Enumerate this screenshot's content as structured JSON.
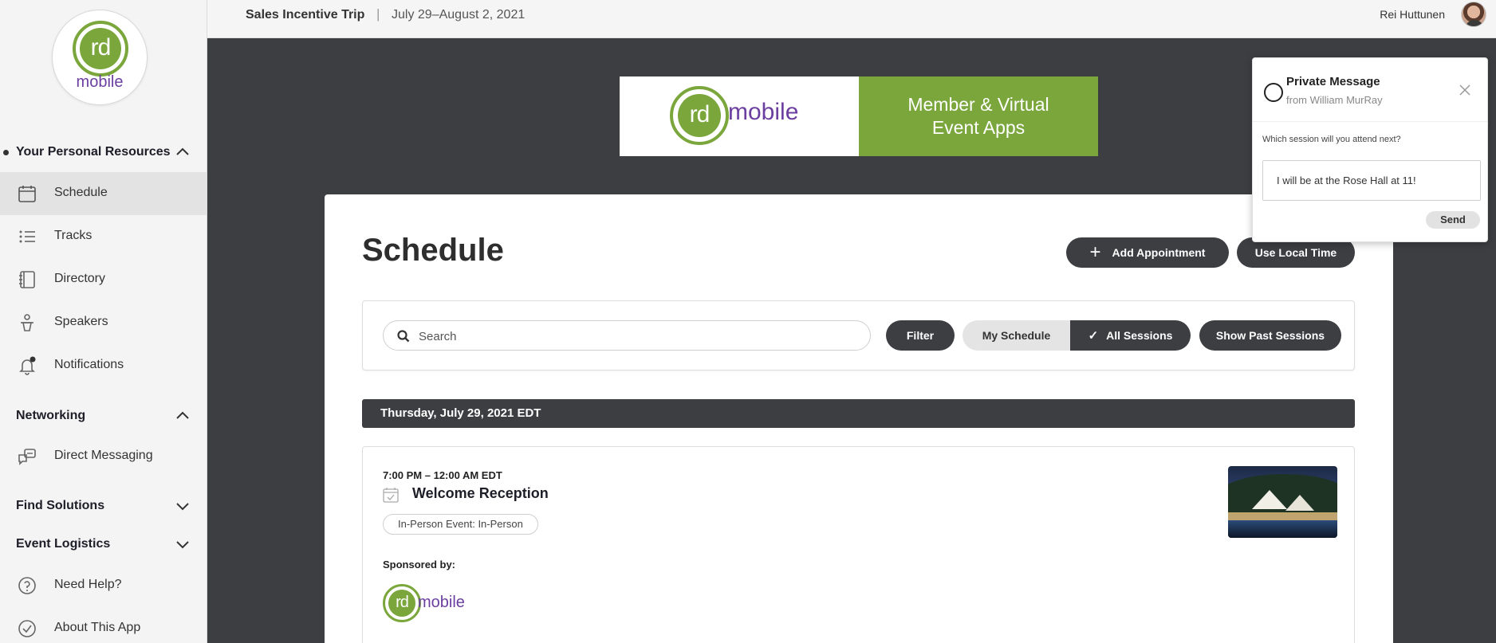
{
  "sidebar": {
    "logo": {
      "monogram": "rd",
      "word": "mobile"
    },
    "sections": {
      "personal": "Your Personal Resources",
      "networking": "Networking",
      "find_solutions": "Find Solutions",
      "event_logistics": "Event Logistics"
    },
    "items": {
      "schedule": "Schedule",
      "tracks": "Tracks",
      "directory": "Directory",
      "speakers": "Speakers",
      "notifications": "Notifications",
      "direct_messaging": "Direct Messaging",
      "need_help": "Need Help?",
      "about": "About This App"
    },
    "active_item": "schedule"
  },
  "topbar": {
    "event_title": "Sales Incentive Trip",
    "separator": "|",
    "dates": "July 29–August 2, 2021",
    "user_name": "Rei Huttunen"
  },
  "banner": {
    "monogram": "rd",
    "word": "mobile",
    "tagline_line1": "Member & Virtual",
    "tagline_line2": "Event Apps"
  },
  "main": {
    "title": "Schedule",
    "add_appointment_label": "Add Appointment",
    "add_icon": "+",
    "local_time_label": "Use Local Time",
    "search_placeholder": "Search",
    "filter_label": "Filter",
    "my_schedule_label": "My Schedule",
    "all_sessions_label": "All Sessions",
    "all_sessions_check": "✓",
    "past_sessions_label": "Show Past Sessions",
    "day_header": "Thursday, July 29, 2021 EDT",
    "session": {
      "time": "7:00 PM – 12:00 AM EDT",
      "name": "Welcome Reception",
      "tag": "In-Person Event: In-Person",
      "sponsored_label": "Sponsored by:",
      "sponsor_monogram": "rd",
      "sponsor_word": "mobile"
    }
  },
  "private_message": {
    "title": "Private Message",
    "from": "from William MurRay",
    "question": "Which session will you attend next?",
    "reply_value": "I will be at the Rose Hall at 11!",
    "send_label": "Send"
  },
  "colors": {
    "brand_green": "#7aa63c",
    "brand_purple": "#6b3fa0",
    "dark": "#3d3e42"
  }
}
